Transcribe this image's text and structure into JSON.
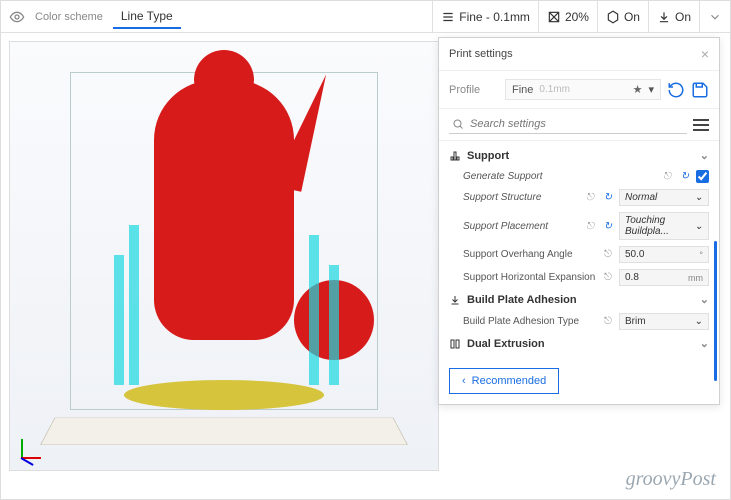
{
  "toolbar": {
    "color_scheme_label": "Color scheme",
    "color_scheme_value": "Line Type",
    "quality": {
      "label": "Fine - 0.1mm"
    },
    "infill": {
      "label": "20%"
    },
    "support": {
      "label": "On"
    },
    "adhesion": {
      "label": "On"
    }
  },
  "panel": {
    "title": "Print settings",
    "profile_label": "Profile",
    "profile_value": "Fine",
    "profile_hint": "0.1mm",
    "search_placeholder": "Search settings",
    "sections": {
      "support": {
        "title": "Support",
        "generate": "Generate Support",
        "structure": "Support Structure",
        "structure_val": "Normal",
        "placement": "Support Placement",
        "placement_val": "Touching Buildpla...",
        "overhang": "Support Overhang Angle",
        "overhang_val": "50.0",
        "overhang_unit": "°",
        "hexp": "Support Horizontal Expansion",
        "hexp_val": "0.8",
        "hexp_unit": "mm"
      },
      "adhesion": {
        "title": "Build Plate Adhesion",
        "type": "Build Plate Adhesion Type",
        "type_val": "Brim"
      },
      "dual": {
        "title": "Dual Extrusion"
      }
    },
    "recommended": "Recommended"
  },
  "watermark": "groovyPost"
}
